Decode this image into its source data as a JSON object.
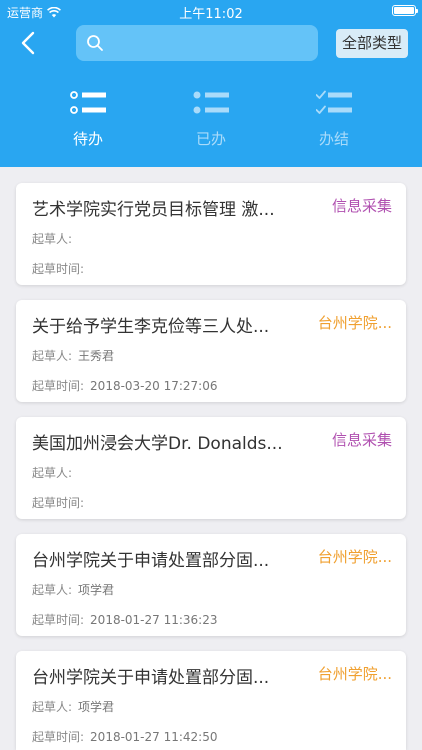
{
  "status_bar": {
    "carrier": "运营商",
    "time": "上午11:02"
  },
  "header": {
    "back_icon": "chevron-left-icon",
    "search_icon": "search-icon",
    "search_placeholder": "",
    "type_button": "全部类型"
  },
  "tabs": [
    {
      "label": "待办",
      "icon": "list-circle-icon",
      "active": true
    },
    {
      "label": "已办",
      "icon": "list-dot-icon",
      "active": false
    },
    {
      "label": "办结",
      "icon": "list-check-icon",
      "active": false
    }
  ],
  "colors": {
    "header_bg": "#29a6f1",
    "tag_purple": "#b050b0",
    "tag_orange": "#f0a030"
  },
  "list": [
    {
      "title": "艺术学院实行党员目标管理 激...",
      "tag": "信息采集",
      "tag_color": "#b050b0",
      "drafter_label": "起草人:",
      "drafter": "",
      "time_label": "起草时间:",
      "time": ""
    },
    {
      "title": "关于给予学生李克俭等三人处...",
      "tag": "台州学院...",
      "tag_color": "#f0a030",
      "drafter_label": "起草人:",
      "drafter": "王秀君",
      "time_label": "起草时间:",
      "time": "2018-03-20 17:27:06"
    },
    {
      "title": "美国加州浸会大学Dr. Donalds...",
      "tag": "信息采集",
      "tag_color": "#b050b0",
      "drafter_label": "起草人:",
      "drafter": "",
      "time_label": "起草时间:",
      "time": ""
    },
    {
      "title": "台州学院关于申请处置部分固...",
      "tag": "台州学院...",
      "tag_color": "#f0a030",
      "drafter_label": "起草人:",
      "drafter": "项学君",
      "time_label": "起草时间:",
      "time": "2018-01-27 11:36:23"
    },
    {
      "title": "台州学院关于申请处置部分固...",
      "tag": "台州学院...",
      "tag_color": "#f0a030",
      "drafter_label": "起草人:",
      "drafter": "项学君",
      "time_label": "起草时间:",
      "time": "2018-01-27 11:42:50"
    }
  ]
}
